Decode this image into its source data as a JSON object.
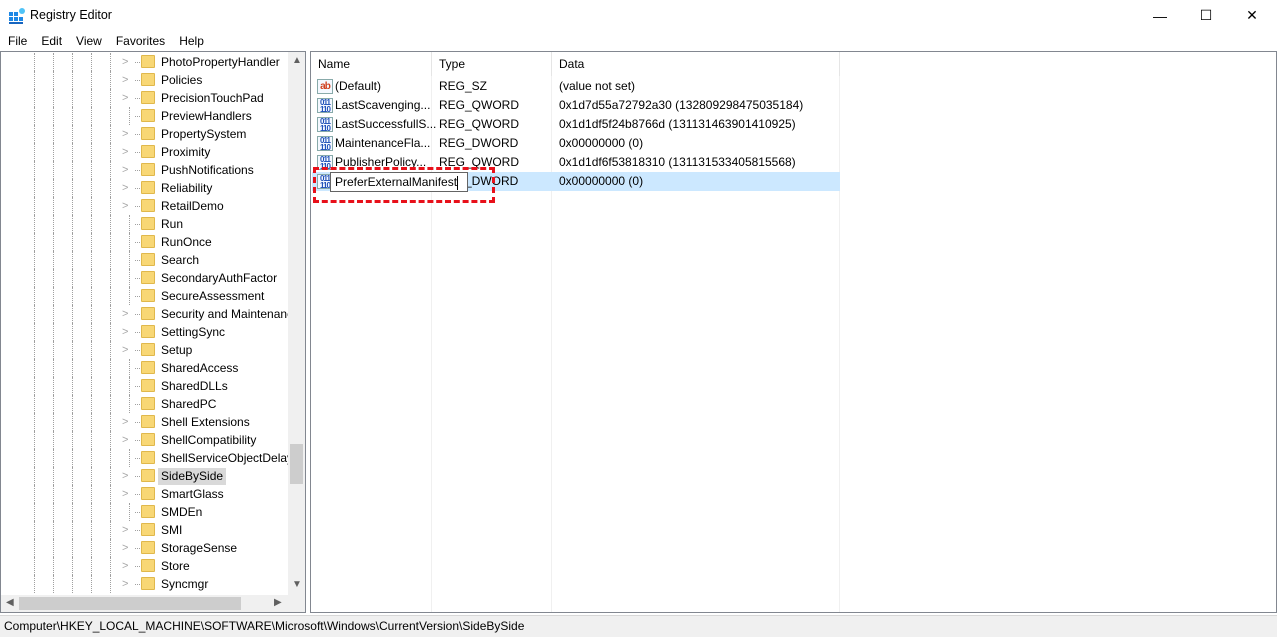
{
  "window": {
    "title": "Registry Editor",
    "minimize": "—",
    "maximize": "☐",
    "close": "✕"
  },
  "menu": [
    "File",
    "Edit",
    "View",
    "Favorites",
    "Help"
  ],
  "tree": {
    "selected": "SideBySide",
    "items": [
      {
        "label": "PhotoPropertyHandler",
        "expandable": true
      },
      {
        "label": "Policies",
        "expandable": true
      },
      {
        "label": "PrecisionTouchPad",
        "expandable": true
      },
      {
        "label": "PreviewHandlers",
        "expandable": false
      },
      {
        "label": "PropertySystem",
        "expandable": true
      },
      {
        "label": "Proximity",
        "expandable": true
      },
      {
        "label": "PushNotifications",
        "expandable": true
      },
      {
        "label": "Reliability",
        "expandable": true
      },
      {
        "label": "RetailDemo",
        "expandable": true
      },
      {
        "label": "Run",
        "expandable": false
      },
      {
        "label": "RunOnce",
        "expandable": false
      },
      {
        "label": "Search",
        "expandable": false
      },
      {
        "label": "SecondaryAuthFactor",
        "expandable": false
      },
      {
        "label": "SecureAssessment",
        "expandable": false
      },
      {
        "label": "Security and Maintenance",
        "expandable": true
      },
      {
        "label": "SettingSync",
        "expandable": true
      },
      {
        "label": "Setup",
        "expandable": true
      },
      {
        "label": "SharedAccess",
        "expandable": false
      },
      {
        "label": "SharedDLLs",
        "expandable": false
      },
      {
        "label": "SharedPC",
        "expandable": false
      },
      {
        "label": "Shell Extensions",
        "expandable": true
      },
      {
        "label": "ShellCompatibility",
        "expandable": true
      },
      {
        "label": "ShellServiceObjectDelayLoad",
        "expandable": false
      },
      {
        "label": "SideBySide",
        "expandable": true
      },
      {
        "label": "SmartGlass",
        "expandable": true
      },
      {
        "label": "SMDEn",
        "expandable": false
      },
      {
        "label": "SMI",
        "expandable": true
      },
      {
        "label": "StorageSense",
        "expandable": true
      },
      {
        "label": "Store",
        "expandable": true
      },
      {
        "label": "Syncmgr",
        "expandable": true
      }
    ]
  },
  "list": {
    "columns": {
      "name": "Name",
      "type": "Type",
      "data": "Data"
    },
    "rows": [
      {
        "name": "(Default)",
        "type": "REG_SZ",
        "data": "(value not set)",
        "icon": "string-value-icon"
      },
      {
        "name": "LastScavenging...",
        "type": "REG_QWORD",
        "data": "0x1d7d55a72792a30 (132809298475035184)",
        "icon": "binary-value-icon"
      },
      {
        "name": "LastSuccessfullS...",
        "type": "REG_QWORD",
        "data": "0x1d1df5f24b8766d (131131463901410925)",
        "icon": "binary-value-icon"
      },
      {
        "name": "MaintenanceFla...",
        "type": "REG_DWORD",
        "data": "0x00000000 (0)",
        "icon": "binary-value-icon"
      },
      {
        "name": "PublisherPolicy...",
        "type": "REG_QWORD",
        "data": "0x1d1df6f53818310 (131131533405815568)",
        "icon": "binary-value-icon"
      },
      {
        "name": "",
        "type": "REG_DWORD",
        "data": "0x00000000 (0)",
        "icon": "binary-value-icon",
        "selected": true
      }
    ],
    "rename_value": "PreferExternalManifest"
  },
  "status": "Computer\\HKEY_LOCAL_MACHINE\\SOFTWARE\\Microsoft\\Windows\\CurrentVersion\\SideBySide"
}
